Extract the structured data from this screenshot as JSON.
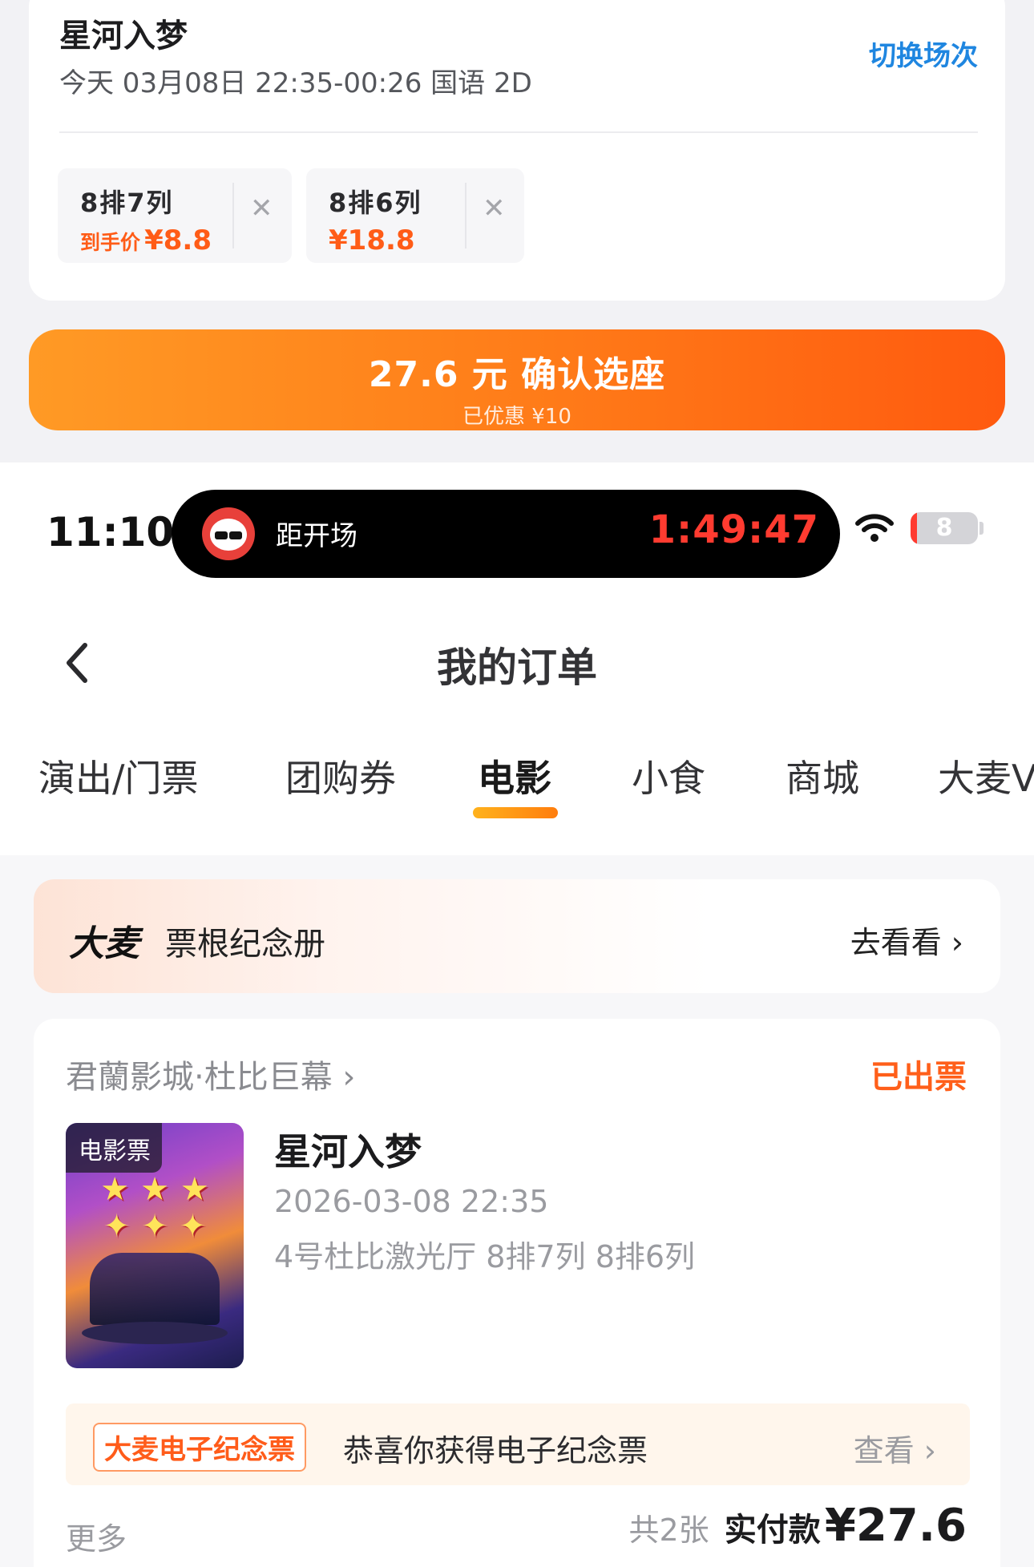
{
  "seat_panel": {
    "movie_title": "星河入梦",
    "show_time": "今天 03月08日 22:35-00:26 国语 2D",
    "switch_label": "切换场次",
    "seats": [
      {
        "seat": "8排7列",
        "price_label": "到手价",
        "price": "¥8.8",
        "remove_icon": "close-icon"
      },
      {
        "seat": "8排6列",
        "price_label": "",
        "price": "¥18.8",
        "remove_icon": "close-icon"
      }
    ],
    "confirm_label": "27.6 元 确认选座",
    "discount_note": "已优惠 ¥10"
  },
  "status_bar": {
    "time": "11:10",
    "live_activity_label": "距开场",
    "countdown": "1:49:47",
    "battery": "8",
    "battery_level": 0.08,
    "icons": [
      "wifi-icon",
      "battery-icon"
    ]
  },
  "nav": {
    "title": "我的订单",
    "back_icon": "chevron-left-icon"
  },
  "tabs": [
    {
      "label": "演出/门票",
      "active": false
    },
    {
      "label": "团购券",
      "active": false
    },
    {
      "label": "电影",
      "active": true
    },
    {
      "label": "小食",
      "active": false
    },
    {
      "label": "商城",
      "active": false
    },
    {
      "label": "大麦V",
      "active": false
    }
  ],
  "banner": {
    "brand": "大麦",
    "title": "票根纪念册",
    "link": "去看看 ›"
  },
  "order": {
    "cinema": "君蘭影城·杜比巨幕 ›",
    "status": "已出票",
    "poster_badge": "电影票",
    "movie": "星河入梦",
    "datetime": "2026-03-08 22:35",
    "hall_seats": "4号杜比激光厅 8排7列 8排6列",
    "souvenir_tag": "大麦电子纪念票",
    "souvenir_text": "恭喜你获得电子纪念票",
    "souvenir_link": "查看 ›",
    "more": "更多",
    "ticket_count": "共2张",
    "paid_label": "实付款",
    "paid_amount": "¥27.6"
  },
  "colors": {
    "accent_orange": "#ff5f1a",
    "link_blue": "#1f86e0",
    "timer_red": "#ff3b30"
  }
}
